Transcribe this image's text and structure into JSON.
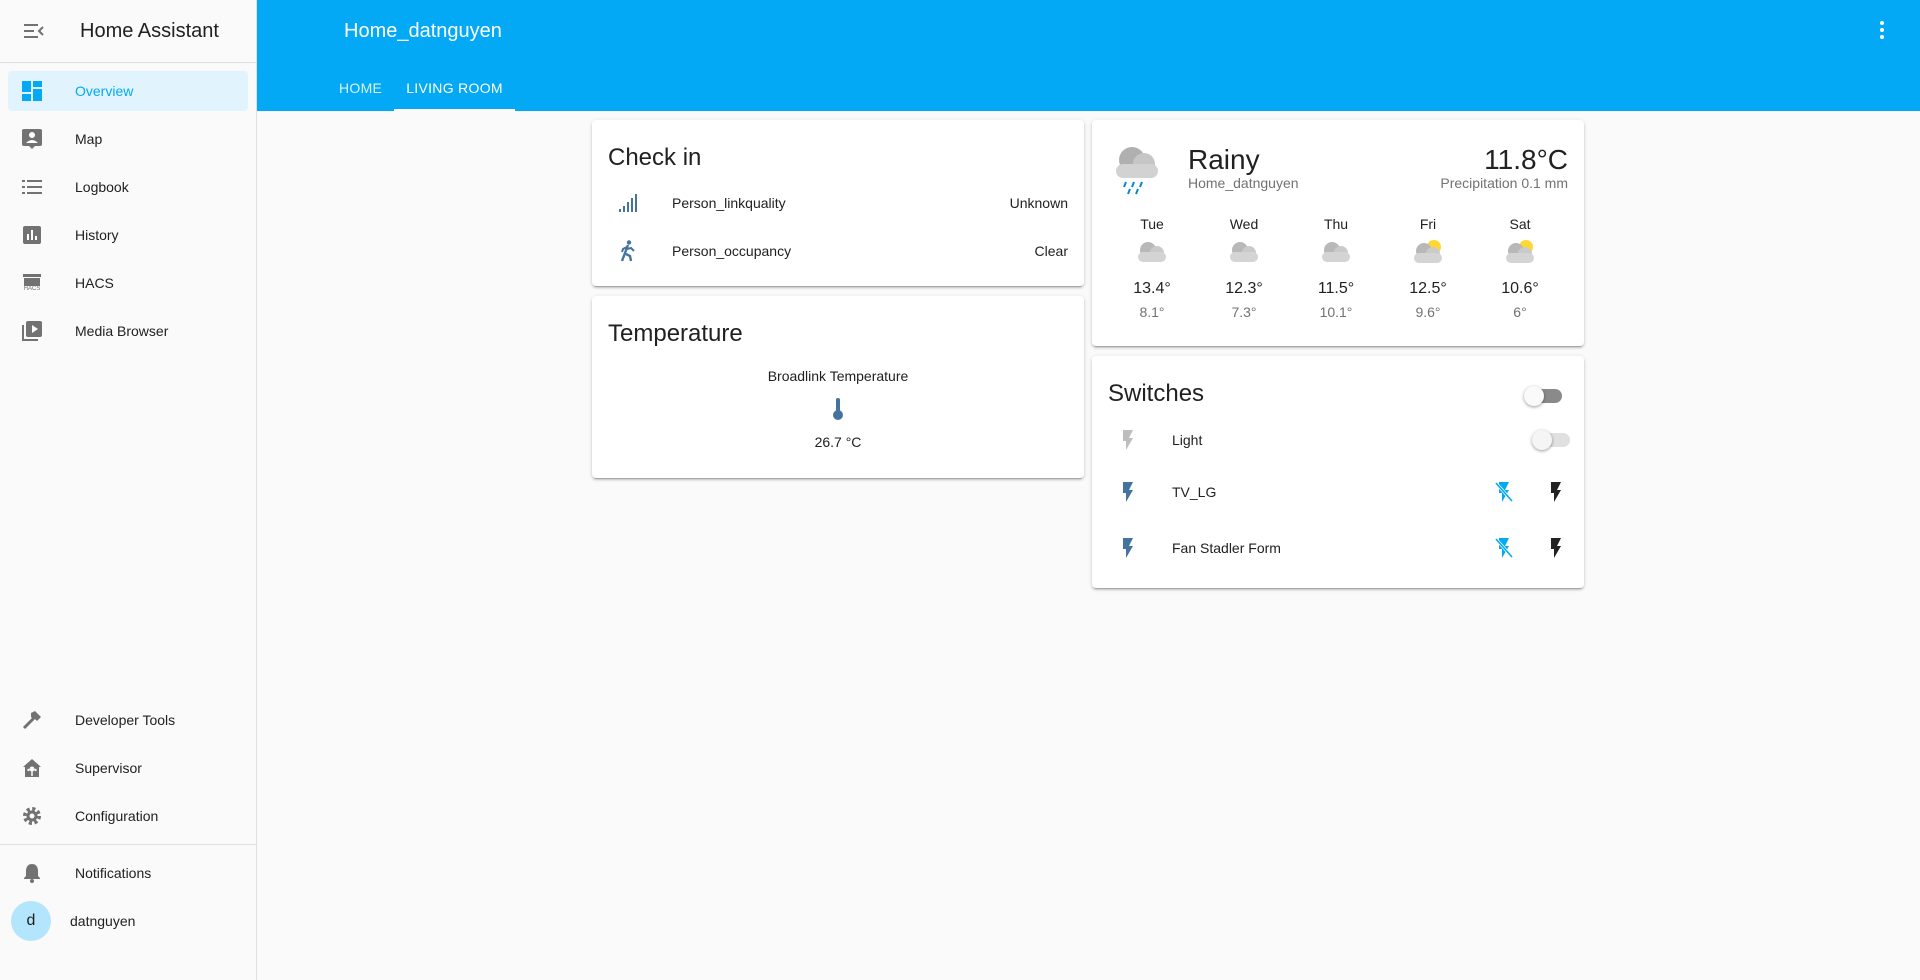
{
  "app": {
    "title": "Home Assistant"
  },
  "sidebar": {
    "items": [
      {
        "label": "Overview"
      },
      {
        "label": "Map"
      },
      {
        "label": "Logbook"
      },
      {
        "label": "History"
      },
      {
        "label": "HACS"
      },
      {
        "label": "Media Browser"
      }
    ],
    "bottom_items": [
      {
        "label": "Developer Tools"
      },
      {
        "label": "Supervisor"
      },
      {
        "label": "Configuration"
      }
    ],
    "notifications_label": "Notifications",
    "user": {
      "initial": "d",
      "name": "datnguyen"
    },
    "hacs_icon_text": "HACS"
  },
  "header": {
    "title": "Home_datnguyen",
    "tabs": [
      {
        "label": "HOME"
      },
      {
        "label": "LIVING ROOM"
      }
    ]
  },
  "checkin_card": {
    "title": "Check in",
    "rows": [
      {
        "name": "Person_linkquality",
        "state": "Unknown"
      },
      {
        "name": "Person_occupancy",
        "state": "Clear"
      }
    ]
  },
  "temperature_card": {
    "title": "Temperature",
    "entity": "Broadlink Temperature",
    "value": "26.7 °C"
  },
  "weather_card": {
    "condition": "Rainy",
    "location": "Home_datnguyen",
    "temperature": "11.8°C",
    "precipitation": "Precipitation 0.1 mm",
    "forecast": [
      {
        "day": "Tue",
        "high": "13.4°",
        "low": "8.1°",
        "icon": "cloudy"
      },
      {
        "day": "Wed",
        "high": "12.3°",
        "low": "7.3°",
        "icon": "cloudy"
      },
      {
        "day": "Thu",
        "high": "11.5°",
        "low": "10.1°",
        "icon": "cloudy"
      },
      {
        "day": "Fri",
        "high": "12.5°",
        "low": "9.6°",
        "icon": "partly-cloudy"
      },
      {
        "day": "Sat",
        "high": "10.6°",
        "low": "6°",
        "icon": "partly-cloudy"
      }
    ]
  },
  "switches_card": {
    "title": "Switches",
    "rows": [
      {
        "name": "Light"
      },
      {
        "name": "TV_LG"
      },
      {
        "name": "Fan Stadler Form"
      }
    ]
  },
  "colors": {
    "primary": "#03a9f4",
    "icon": "#44739e",
    "sidebar_icon": "#727272"
  }
}
